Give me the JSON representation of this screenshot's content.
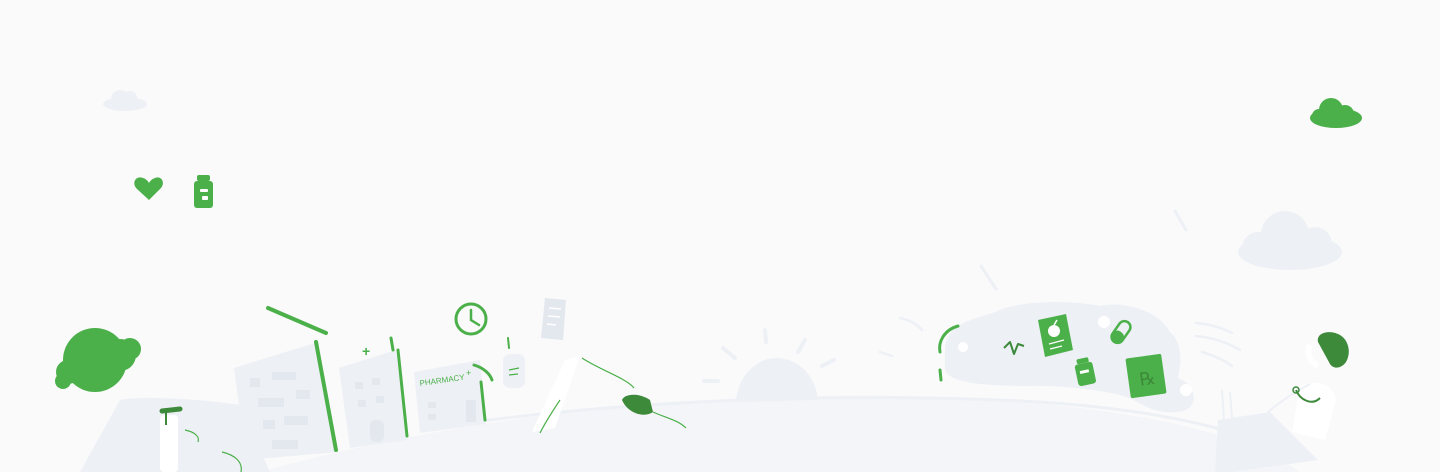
{
  "illustration": {
    "pharmacy_sign": "PHARMACY",
    "pharmacy_cross": "+",
    "rx_symbol": "℞",
    "palette": {
      "background": "#fafafb",
      "ground": "#edf0f5",
      "accent_green": "#4cb04a",
      "dark_green": "#3d8a3b"
    },
    "icons": [
      "heart-icon",
      "medicine-bottle-icon",
      "clock-icon",
      "prescription-paper-icon",
      "pill-capsule-icon",
      "rx-book-icon",
      "nutrition-card-icon",
      "heartbeat-icon",
      "cloud-icon",
      "sun-icon",
      "tree-icon"
    ]
  }
}
